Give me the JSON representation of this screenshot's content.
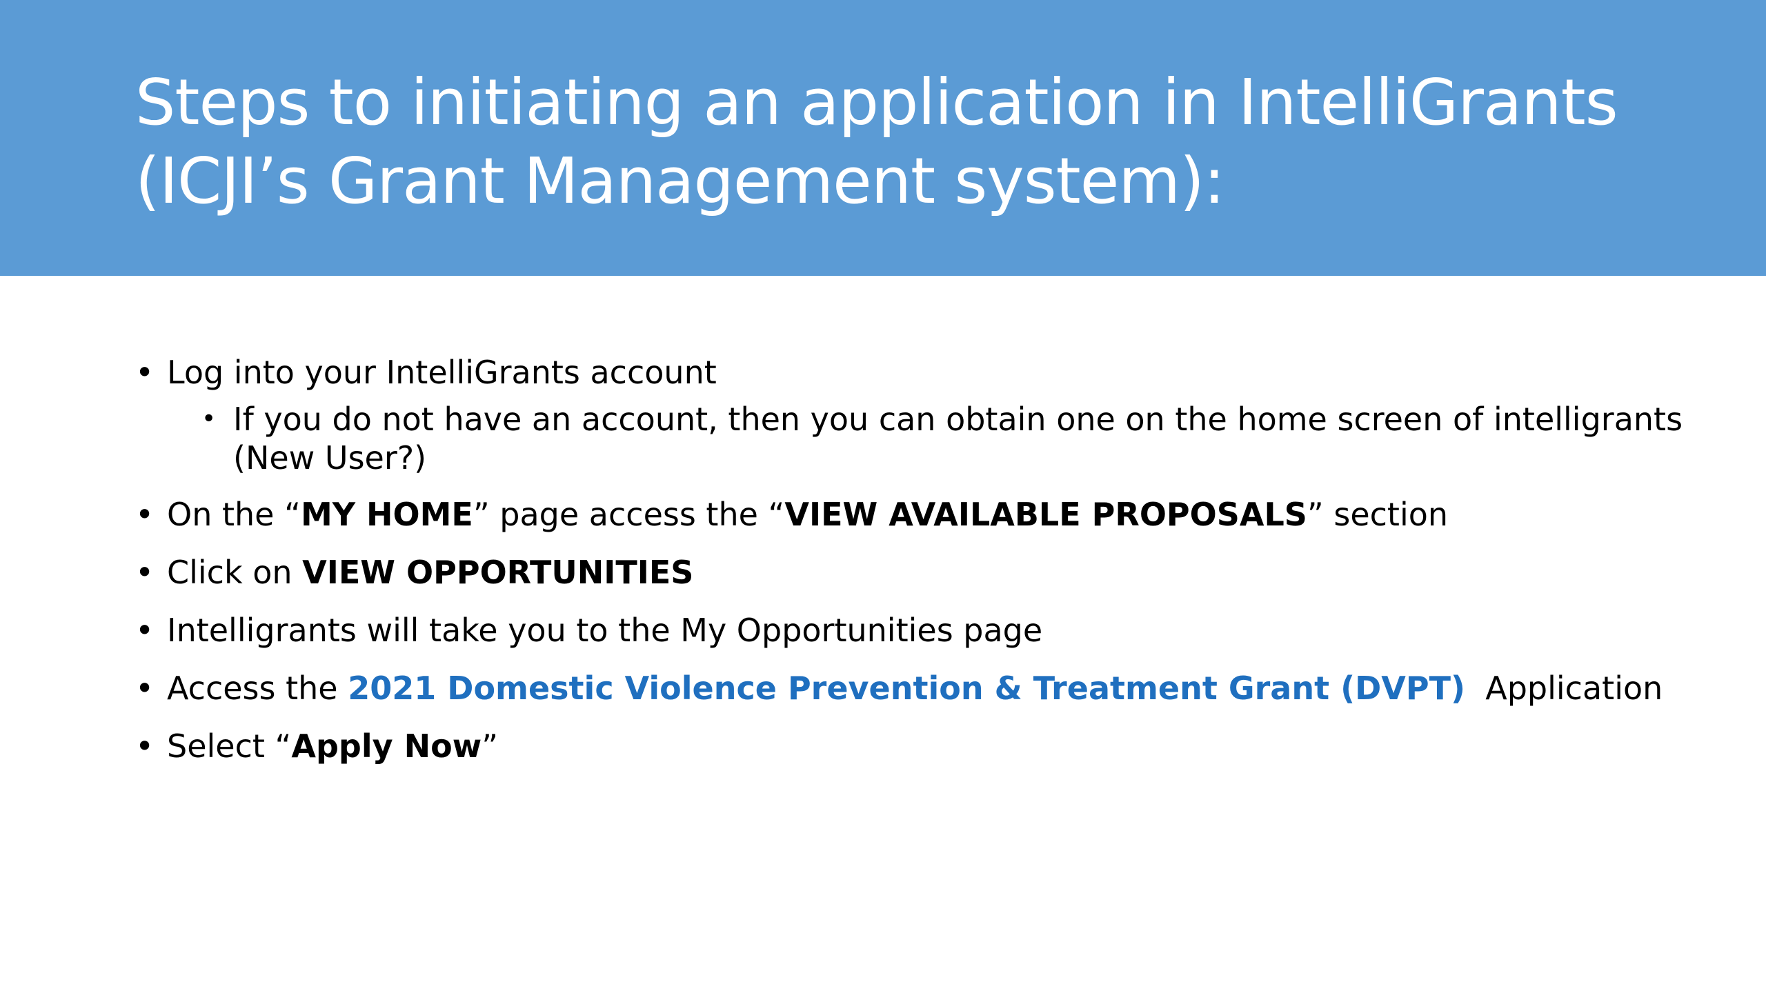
{
  "title": {
    "line1": "Steps to initiating an application in IntelliGrants",
    "line2": "(ICJI’s Grant Management system):"
  },
  "colors": {
    "header_bg": "#5B9BD5",
    "title_text": "#FFFFFF",
    "link_text": "#1F6FBF",
    "body_text": "#000000"
  },
  "bullet_glyph": "•",
  "items": {
    "login": {
      "text": "Log into your IntelliGrants account"
    },
    "login_sub": {
      "line1": "If you do not have an account, then you can obtain one on the home screen of intelligrants",
      "line2": "(New User?)"
    },
    "myhome": {
      "pre": "On the “",
      "bold1": "MY HOME",
      "mid": "” page access the “",
      "bold2": "VIEW AVAILABLE PROPOSALS",
      "post": "” section"
    },
    "click": {
      "pre": "Click on ",
      "bold": "VIEW OPPORTUNITIES"
    },
    "take": {
      "text": "Intelligrants will take you to the My Opportunities page"
    },
    "access": {
      "pre": "Access the ",
      "link": "2021 Domestic Violence Prevention & Treatment Grant (DVPT)",
      "post": "  Application"
    },
    "select": {
      "pre": "Select “",
      "bold": "Apply Now",
      "post": "”"
    }
  }
}
